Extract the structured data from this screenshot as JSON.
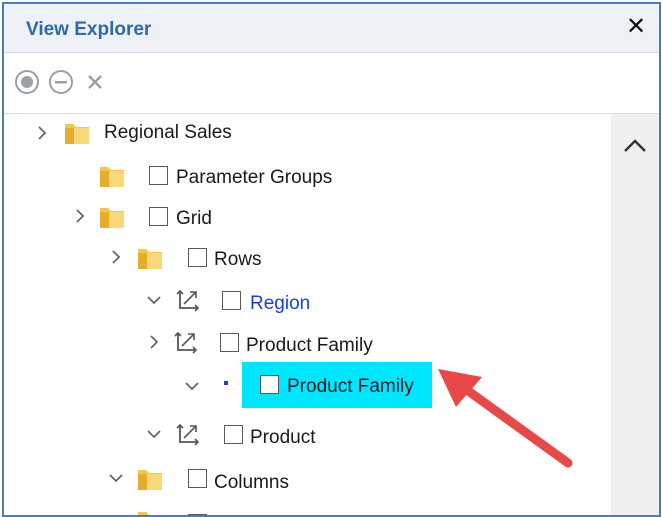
{
  "panel": {
    "title": "View Explorer",
    "close_symbol": "✕"
  },
  "toolbar": {
    "icons": [
      "record-icon",
      "remove-icon",
      "close-icon"
    ]
  },
  "tree": {
    "nodes": [
      {
        "label": "Regional Sales",
        "icon": "folder-icon",
        "expand": "collapsed",
        "checkbox": false
      },
      {
        "label": "Parameter Groups",
        "icon": "folder-icon",
        "expand": "none",
        "checkbox": true
      },
      {
        "label": "Grid",
        "icon": "folder-icon",
        "expand": "collapsed",
        "checkbox": true
      },
      {
        "label": "Rows",
        "icon": "folder-icon",
        "expand": "collapsed",
        "checkbox": true
      },
      {
        "label": "Region",
        "icon": "pivot-icon",
        "expand": "expanded",
        "checkbox": true
      },
      {
        "label": "Product Family",
        "icon": "pivot-icon",
        "expand": "collapsed",
        "checkbox": true
      },
      {
        "label": "Product Family",
        "icon": "member-dot-icon",
        "expand": "expanded",
        "checkbox": true,
        "selected": true
      },
      {
        "label": "Product",
        "icon": "pivot-icon",
        "expand": "expanded",
        "checkbox": true
      },
      {
        "label": "Columns",
        "icon": "folder-icon",
        "expand": "expanded",
        "checkbox": true
      }
    ]
  },
  "colors": {
    "title": "#2f6aa8",
    "selection": "#00e5ff",
    "link": "#1d3fd8",
    "annotation_arrow": "#e84848"
  }
}
